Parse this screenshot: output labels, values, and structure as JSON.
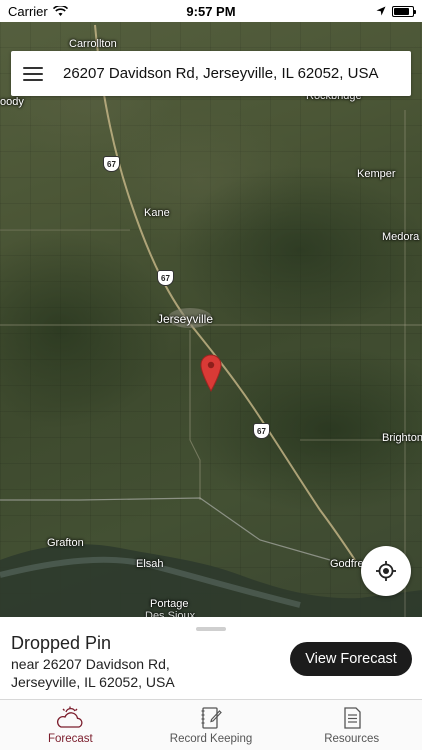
{
  "status_bar": {
    "carrier": "Carrier",
    "time": "9:57 PM",
    "wifi_icon": "wifi-icon",
    "location_icon": "location-arrow-icon",
    "battery_level": 0.85
  },
  "search": {
    "menu_icon": "hamburger-menu-icon",
    "address": "26207 Davidson Rd, Jerseyville, IL 62052, USA"
  },
  "map": {
    "labels": {
      "carrollton": "Carrollton",
      "woody": "oody",
      "rockbridge": "Rockbridge",
      "kemper": "Kemper",
      "kane": "Kane",
      "medora": "Medora",
      "jerseyville": "Jerseyville",
      "brighton": "Brighton",
      "grafton": "Grafton",
      "elsah": "Elsah",
      "godfrey": "Godfre",
      "portage": "Portage",
      "portage2": "Des Sioux"
    },
    "route_shields": {
      "r1": "67",
      "r2": "67",
      "r3": "67"
    },
    "pin_color": "#d93a36"
  },
  "sheet": {
    "title": "Dropped Pin",
    "address_line1": "near 26207 Davidson Rd,",
    "address_line2": "Jerseyville, IL 62052, USA",
    "view_button": "View Forecast"
  },
  "locate_icon": "crosshair-locate-icon",
  "tabs": [
    {
      "label": "Forecast",
      "icon": "cloud-sun-icon",
      "active": true
    },
    {
      "label": "Record Keeping",
      "icon": "notebook-pencil-icon",
      "active": false
    },
    {
      "label": "Resources",
      "icon": "document-icon",
      "active": false
    }
  ],
  "colors": {
    "accent": "#7b1d2c",
    "button_bg": "#1c1c1c"
  }
}
